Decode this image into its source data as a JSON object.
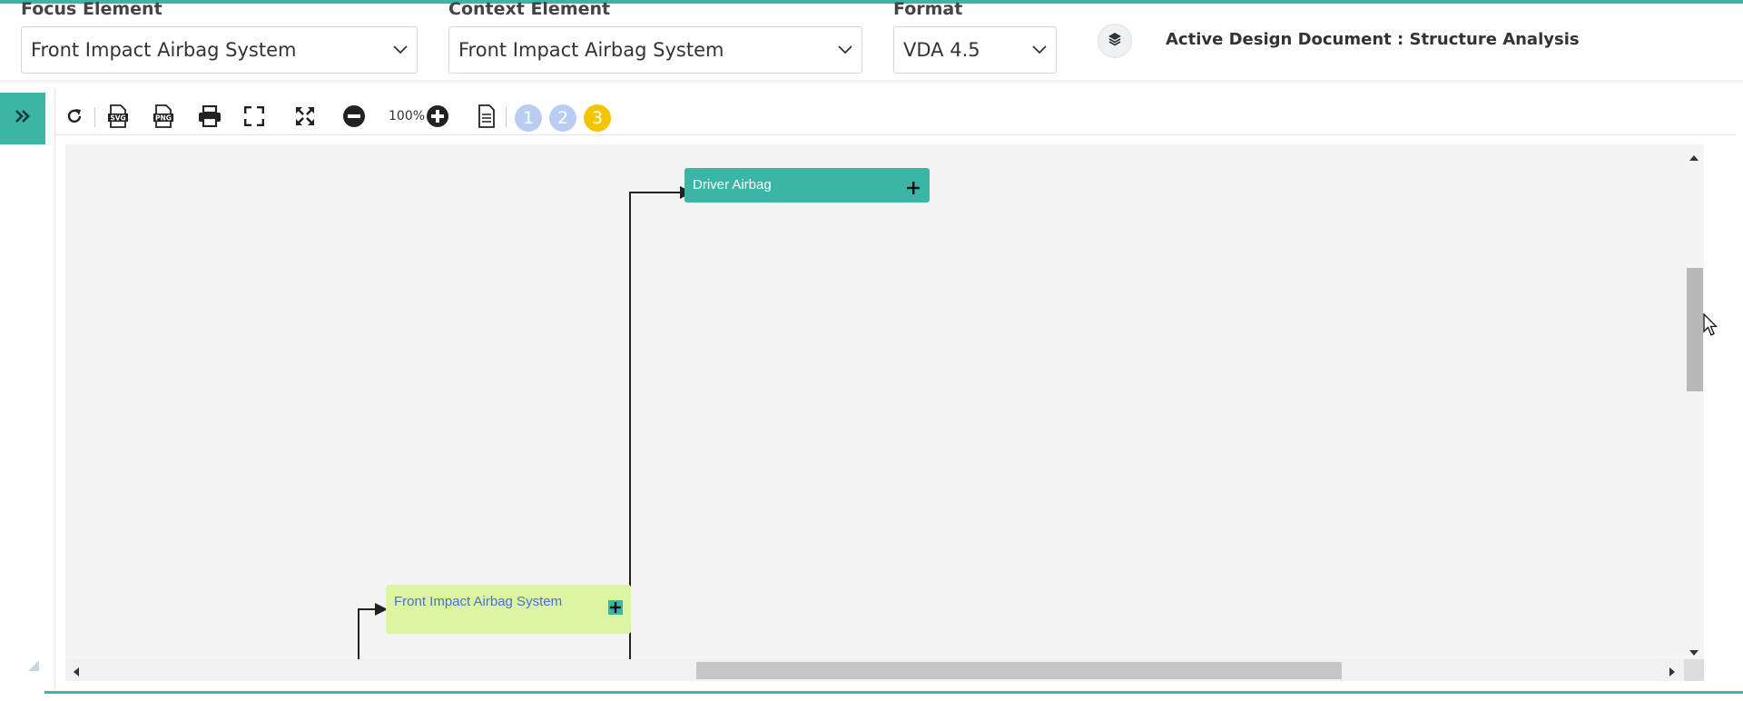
{
  "filters": {
    "focus": {
      "label": "Focus Element",
      "value": "Front Impact Airbag System"
    },
    "context": {
      "label": "Context Element",
      "value": "Front Impact Airbag System"
    },
    "format": {
      "label": "Format",
      "value": "VDA 4.5"
    }
  },
  "active_document": "Active Design Document : Structure Analysis",
  "toolbar": {
    "zoom": "100%",
    "levels": [
      {
        "label": "1",
        "color": "#b9cdf2"
      },
      {
        "label": "2",
        "color": "#b9cdf2"
      },
      {
        "label": "3",
        "color": "#f2c500"
      }
    ],
    "icons": [
      "refresh-icon",
      "svg-export-icon",
      "png-export-icon",
      "print-icon",
      "fullscreen-icon",
      "fit-icon",
      "zoom-out-icon",
      "zoom-in-icon",
      "report-icon"
    ]
  },
  "diagram": {
    "nodes": [
      {
        "label": "Driver Airbag",
        "plus": "+",
        "color": "#3ab5a6"
      },
      {
        "label": "Front Impact Airbag System",
        "plus": "+",
        "color": "#dcf5a3"
      }
    ]
  },
  "colors": {
    "accent": "#3ab5a6",
    "canvas": "#f4f4f4"
  }
}
